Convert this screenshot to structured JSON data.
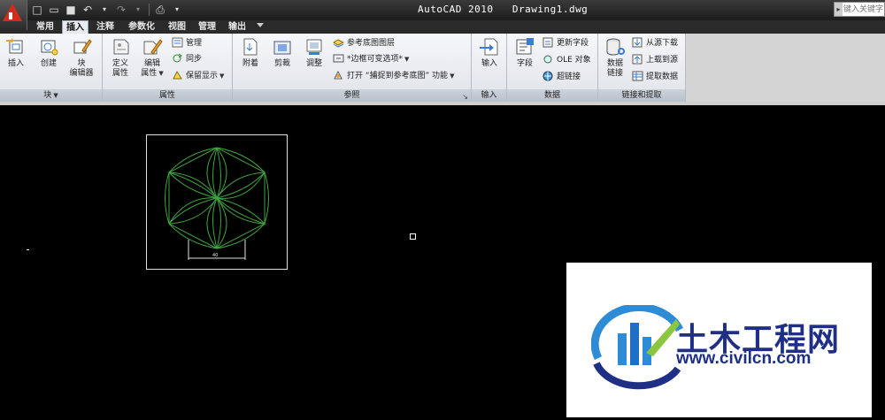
{
  "window": {
    "title": "AutoCAD 2010   Drawing1.dwg"
  },
  "search": {
    "placeholder": "键入关键字"
  },
  "tabs": [
    "常用",
    "插入",
    "注释",
    "参数化",
    "视图",
    "管理",
    "输出"
  ],
  "active_tab": "插入",
  "ribbon": {
    "block": {
      "label": "块",
      "insert": "插入",
      "create": "创建",
      "editor_1": "块",
      "editor_2": "编辑器"
    },
    "attributes": {
      "label": "属性",
      "define_1": "定义",
      "define_2": "属性",
      "edit_1": "编辑",
      "edit_2": "属性",
      "manage": "管理",
      "sync": "同步",
      "retain": "保留显示"
    },
    "reference": {
      "label": "参照",
      "attach": "附着",
      "clip": "剪裁",
      "adjust": "调整",
      "underlay_layers": "参考底图图层",
      "frames": "*边框可变选项*",
      "snap": "打开 “捕捉到参考底图” 功能"
    },
    "import": {
      "label": "输入",
      "import": "输入"
    },
    "data": {
      "label": "数据",
      "field": "字段",
      "update_fields": "更新字段",
      "ole": "OLE 对象",
      "hyperlink": "超链接"
    },
    "linking": {
      "label": "链接和提取",
      "data_link_1": "数据",
      "data_link_2": "链接",
      "download": "从源下载",
      "upload": "上载到源",
      "extract": "提取数据"
    }
  },
  "drawing": {
    "dimension_text": "40"
  },
  "watermark": {
    "name": "土木工程网",
    "url": "www.civilcn.com"
  }
}
